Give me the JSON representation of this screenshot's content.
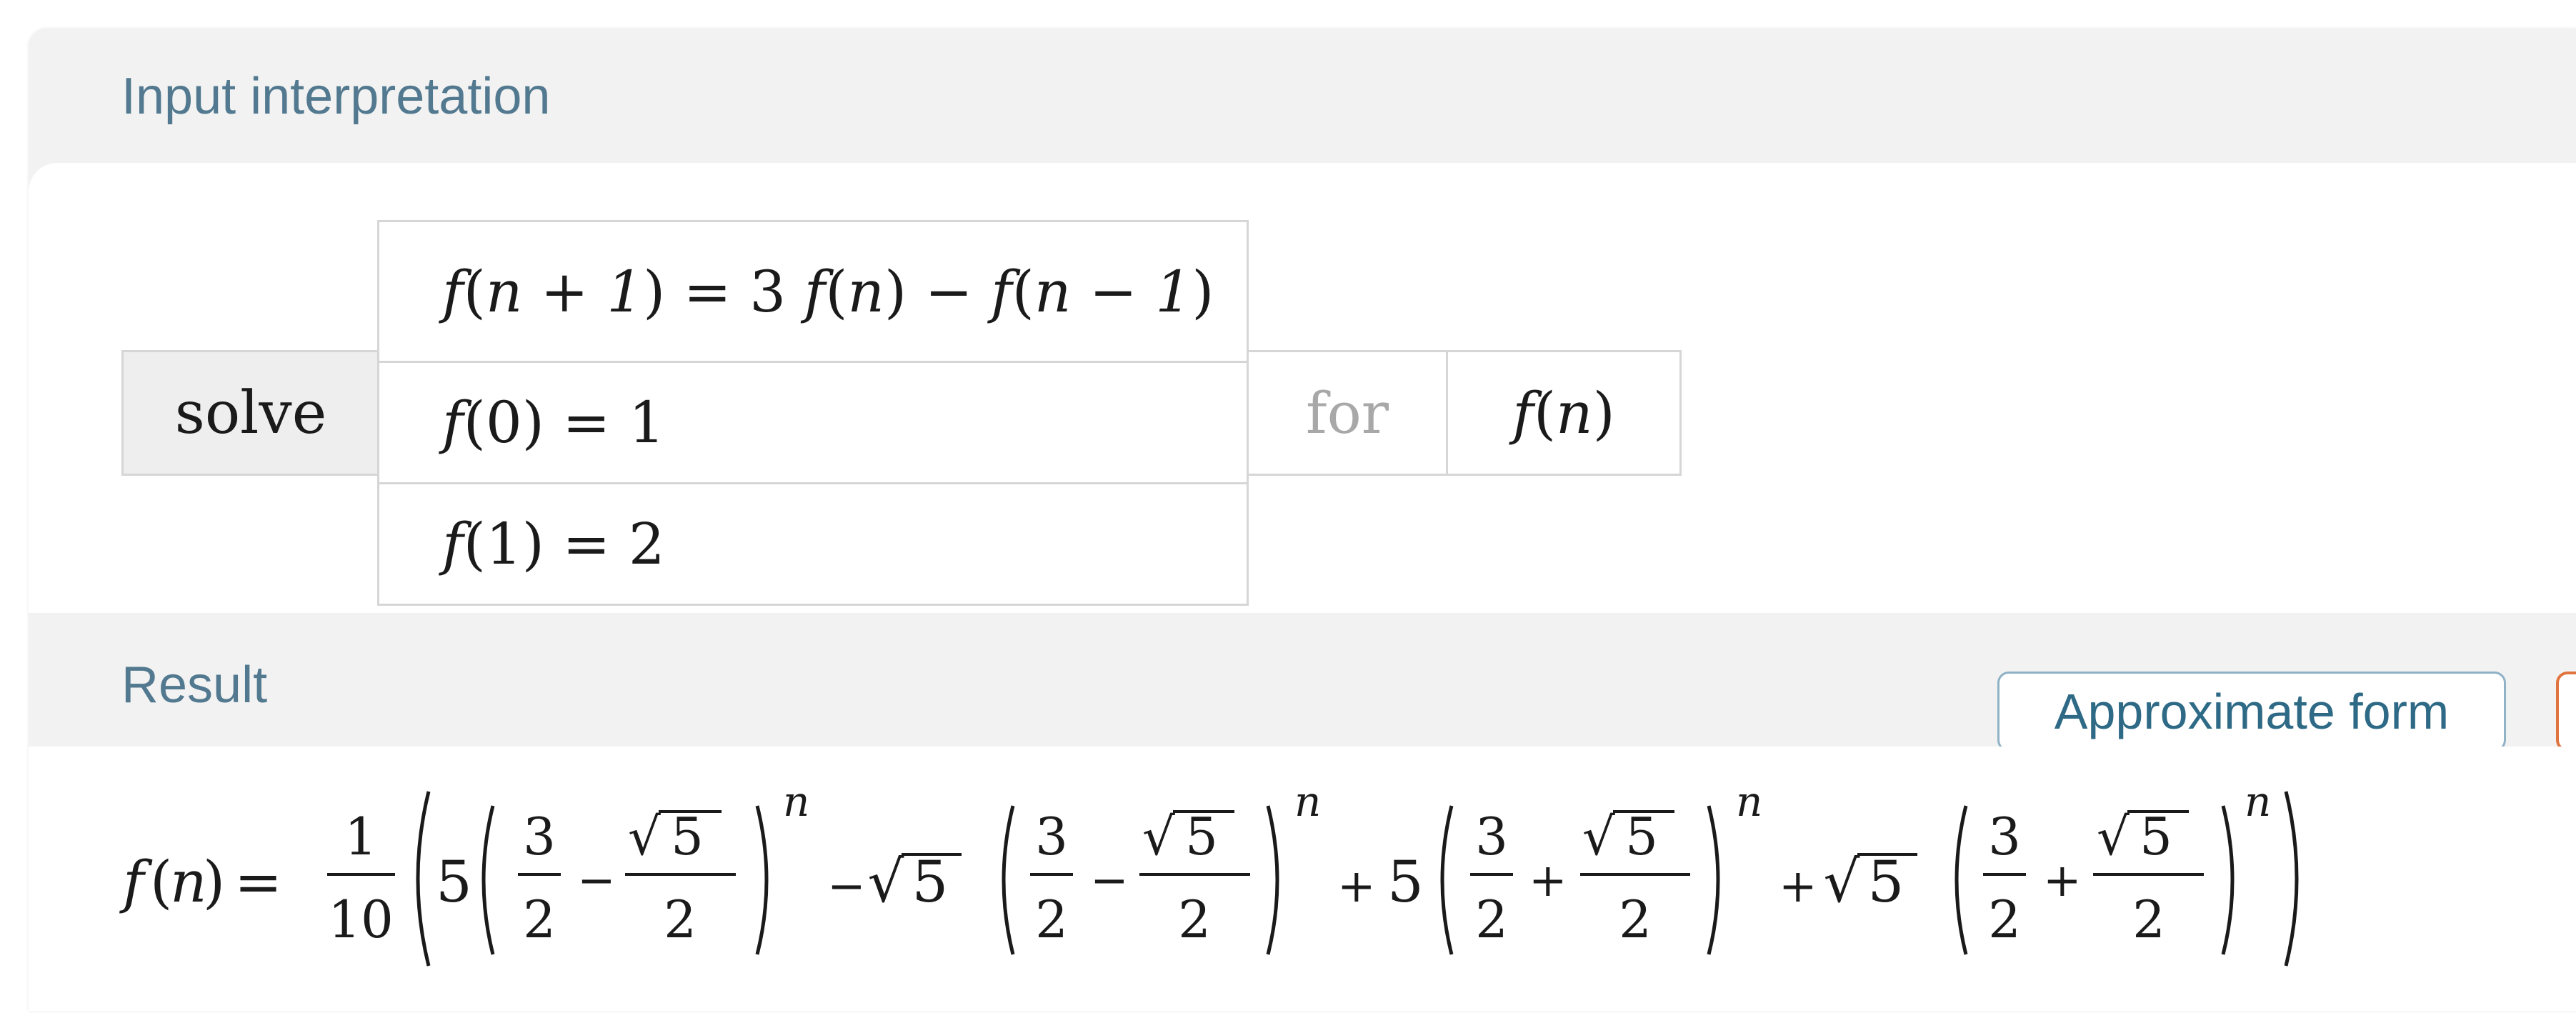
{
  "input_pod": {
    "title": "Input interpretation",
    "command": "solve",
    "equations": [
      {
        "lhs": "f",
        "arg": "n + 1",
        "rhs": " = 3 ",
        "rhs2": "f",
        "rhs2_arg": "n",
        "rhs3": " − ",
        "rhs4": "f",
        "rhs4_arg": "n − 1"
      },
      {
        "text_f": "f",
        "text": "(0) = 1"
      },
      {
        "text_f": "f",
        "text": "(1) = 2"
      }
    ],
    "for_label": "for",
    "variable_f": "f",
    "variable_n": "n"
  },
  "result_pod": {
    "title": "Result",
    "approximate_form_label": "Approximate form",
    "formula": {
      "lhs_f": "f",
      "lhs_n": "n",
      "equals": "=",
      "frac_num": "1",
      "frac_den": "10",
      "coef5": "5",
      "three": "3",
      "two": "2",
      "five": "5",
      "minus": "−",
      "plus": "+",
      "exponent": "n"
    }
  }
}
